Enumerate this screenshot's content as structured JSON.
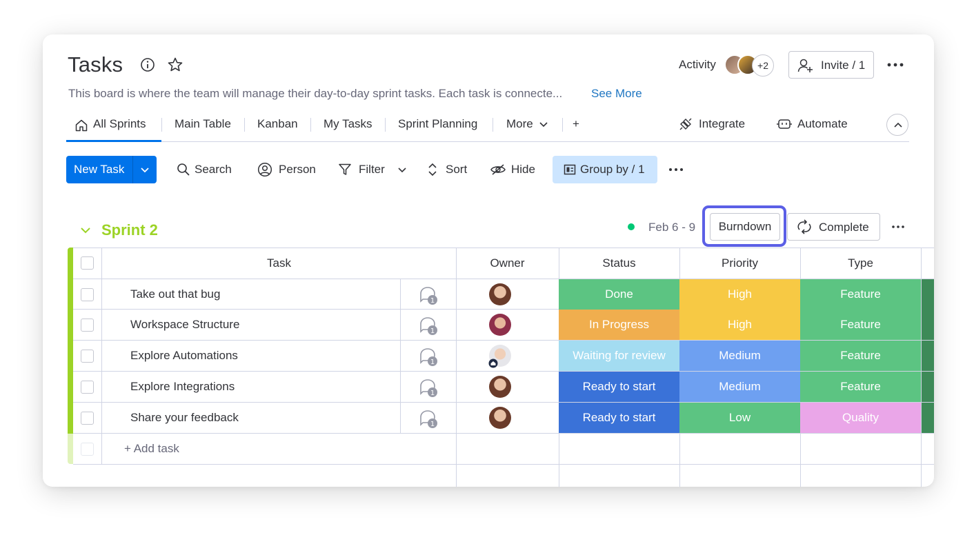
{
  "header": {
    "title": "Tasks",
    "description": "This board is where the team will manage their day-to-day sprint tasks. Each task is connecte...",
    "see_more": "See More",
    "activity_label": "Activity",
    "activity_extra": "+2",
    "invite_label": "Invite / 1"
  },
  "tabs": [
    {
      "label": "All Sprints",
      "active": true
    },
    {
      "label": "Main Table"
    },
    {
      "label": "Kanban"
    },
    {
      "label": "My Tasks"
    },
    {
      "label": "Sprint Planning"
    },
    {
      "label": "More"
    },
    {
      "label": "+"
    }
  ],
  "tab_actions": {
    "integrate": "Integrate",
    "automate": "Automate"
  },
  "toolbar": {
    "new_task": "New Task",
    "search": "Search",
    "person": "Person",
    "filter": "Filter",
    "sort": "Sort",
    "hide": "Hide",
    "group_by": "Group by / 1"
  },
  "sprint": {
    "title": "Sprint 2",
    "dates": "Feb 6 - 9",
    "burndown": "Burndown",
    "complete": "Complete"
  },
  "table": {
    "columns": {
      "task": "Task",
      "owner": "Owner",
      "status": "Status",
      "priority": "Priority",
      "type": "Type"
    },
    "rows": [
      {
        "task": "Take out that bug",
        "updates": "1",
        "status": "Done",
        "status_color": "#5cc482",
        "priority": "High",
        "priority_color": "#f7c944",
        "type": "Feature",
        "type_color": "#5cc482"
      },
      {
        "task": "Workspace Structure",
        "updates": "1",
        "status": "In Progress",
        "status_color": "#f0ae4e",
        "priority": "High",
        "priority_color": "#f7c944",
        "type": "Feature",
        "type_color": "#5cc482"
      },
      {
        "task": "Explore Automations",
        "updates": "1",
        "status": "Waiting for review",
        "status_color": "#a3dcf1",
        "priority": "Medium",
        "priority_color": "#6ea0f1",
        "type": "Feature",
        "type_color": "#5cc482"
      },
      {
        "task": "Explore Integrations",
        "updates": "1",
        "status": "Ready to start",
        "status_color": "#3a72d8",
        "priority": "Medium",
        "priority_color": "#6ea0f1",
        "type": "Feature",
        "type_color": "#5cc482"
      },
      {
        "task": "Share your feedback",
        "updates": "1",
        "status": "Ready to start",
        "status_color": "#3a72d8",
        "priority": "Low",
        "priority_color": "#5cc482",
        "type": "Quality",
        "type_color": "#eaa6e8"
      }
    ],
    "add_task": "+ Add task"
  },
  "colors": {
    "accent": "#0073ea",
    "sprint_green": "#9cd326",
    "highlight_ring": "#5b5fe6"
  }
}
